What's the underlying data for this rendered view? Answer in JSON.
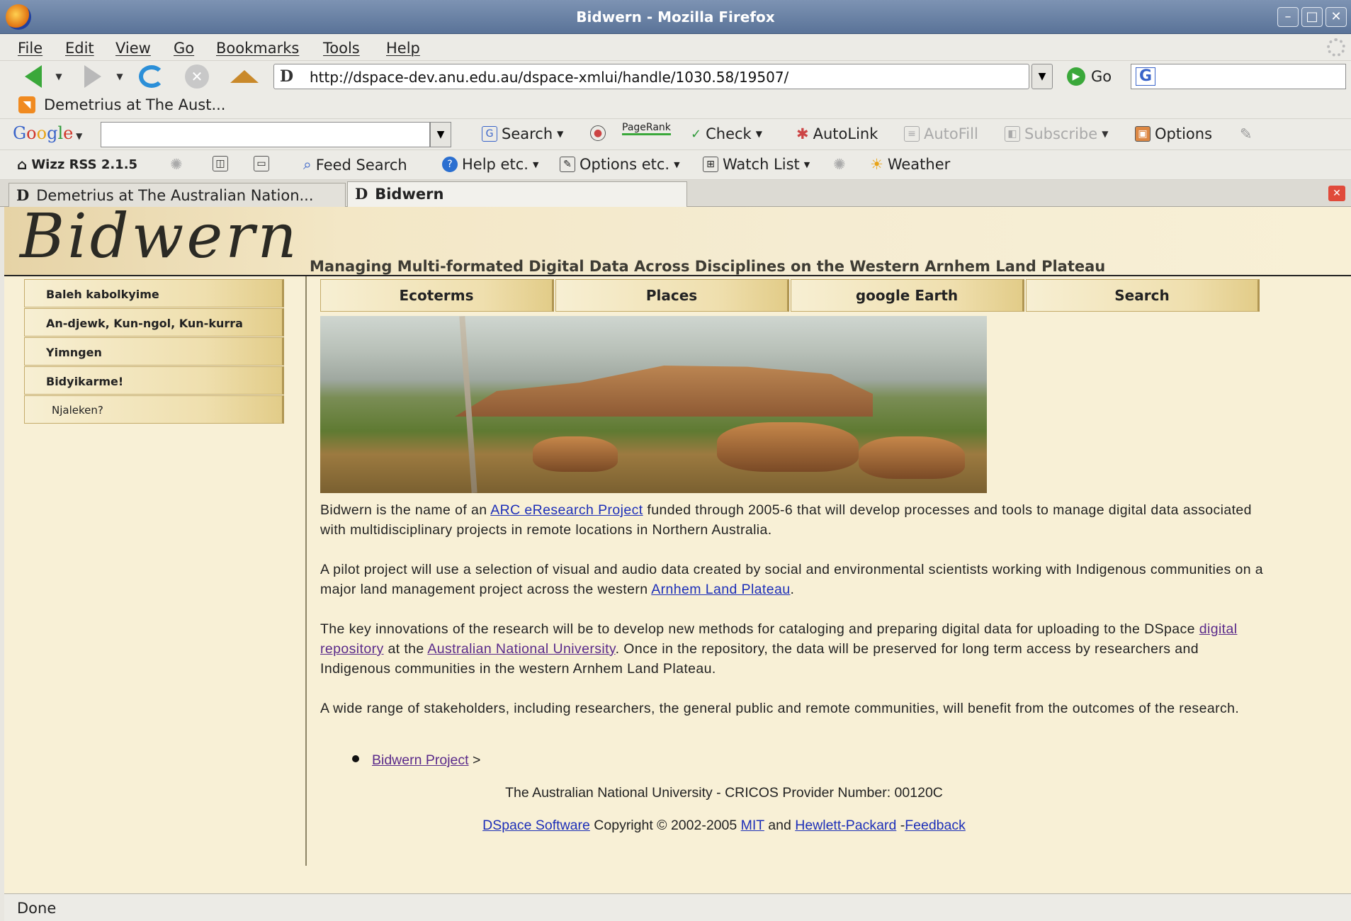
{
  "window": {
    "title": "Bidwern - Mozilla Firefox",
    "buttons": [
      "–",
      "□",
      "✕"
    ]
  },
  "menu": [
    "File",
    "Edit",
    "View",
    "Go",
    "Bookmarks",
    "Tools",
    "Help"
  ],
  "nav": {
    "url": "http://dspace-dev.anu.edu.au/dspace-xmlui/handle/1030.58/19507/",
    "go_label": "Go",
    "site_favicon": "D"
  },
  "bookmarks": {
    "item": "Demetrius at The Aust..."
  },
  "google_toolbar": {
    "logo": "Google",
    "search": "Search",
    "pagerank": "PageRank",
    "check": "Check",
    "autolink": "AutoLink",
    "autofill": "AutoFill",
    "subscribe": "Subscribe",
    "options": "Options"
  },
  "wizz_toolbar": {
    "rss": "Wizz RSS 2.1.5",
    "feed_search": "Feed Search",
    "help": "Help etc.",
    "options": "Options etc.",
    "watch": "Watch List",
    "weather": "Weather"
  },
  "tabs": [
    {
      "label": "Demetrius at The Australian Nation...",
      "active": false
    },
    {
      "label": "Bidwern",
      "active": true
    }
  ],
  "page": {
    "logo": "Bidwern",
    "tagline": "Managing Multi-formated Digital Data Across Disciplines on the Western Arnhem Land Plateau",
    "sidebar": [
      "Baleh kabolkyime",
      "An-djewk, Kun-ngol, Kun-kurra",
      "Yimngen",
      "Bidyikarme!",
      "Njaleken?"
    ],
    "topnav": [
      "Ecoterms",
      "Places",
      "google Earth",
      "Search"
    ],
    "p1": {
      "a": "Bidwern is the name of an ",
      "link": "ARC eResearch Project",
      "b": " funded through 2005-6 that will develop processes and tools to manage digital data associated with multidisciplinary projects in remote locations in Northern Australia."
    },
    "p2": {
      "a": "A pilot project will use a selection of visual and audio data created by social and environmental scientists working with Indigenous communities on a major land management project across the western ",
      "link": "Arnhem Land Plateau",
      "b": "."
    },
    "p3": {
      "a": "The key innovations of the research will be to develop new methods for cataloging and preparing digital data for uploading to the DSpace ",
      "link1": "digital repository",
      "b": " at the ",
      "link2": "Australian National University",
      "c": ". Once in the repository, the data will be preserved for long term access by researchers and Indigenous communities in the western Arnhem Land Plateau."
    },
    "p4": "A wide range of stakeholders, including researchers, the general public and remote communities, will benefit from the outcomes of the research.",
    "bullet": {
      "link": "Bidwern Project",
      "suffix": " >"
    },
    "footer": {
      "line1": "The Australian National University - CRICOS Provider Number: 00120C",
      "dspace": "DSpace Software",
      "copyright": " Copyright © 2002-2005 ",
      "mit": "MIT",
      "and": " and ",
      "hp": "Hewlett-Packard",
      "dash": " -",
      "feedback": "Feedback"
    }
  },
  "status": "Done"
}
